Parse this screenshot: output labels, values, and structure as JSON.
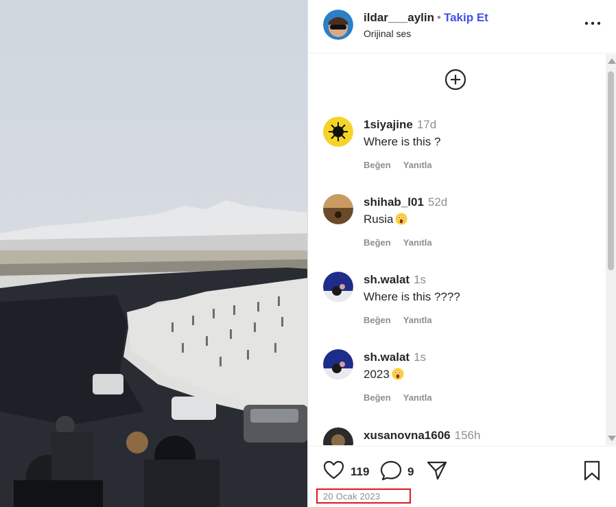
{
  "post": {
    "username": "ildar___aylin",
    "separator": "•",
    "follow_label": "Takip Et",
    "audio_label": "Orijinal ses",
    "more_icon": "more-horizontal-icon"
  },
  "comments": [
    {
      "username": "1siyajine",
      "time": "17d",
      "text": "Where is this ?",
      "emoji": "",
      "like_label": "Beğen",
      "reply_label": "Yanıtla",
      "avatar_color": "#f5d327"
    },
    {
      "username": "shihab_l01",
      "time": "52d",
      "text": "Rusia",
      "emoji": "astonished-face",
      "like_label": "Beğen",
      "reply_label": "Yanıtla",
      "avatar_color": "#6b4a2a"
    },
    {
      "username": "sh.walat",
      "time": "1s",
      "text": "Where is this ????",
      "emoji": "",
      "like_label": "Beğen",
      "reply_label": "Yanıtla",
      "avatar_color": "#1f2d8a"
    },
    {
      "username": "sh.walat",
      "time": "1s",
      "text": "2023",
      "emoji": "astonished-face",
      "like_label": "Beğen",
      "reply_label": "Yanıtla",
      "avatar_color": "#1f2d8a"
    },
    {
      "username": "xusanovna1606",
      "time": "156h",
      "text": "",
      "emoji": "",
      "like_label": "",
      "reply_label": "",
      "avatar_color": "#2b2b2b"
    }
  ],
  "actions": {
    "likes": "119",
    "comments": "9",
    "date": "20 Ocak 2023"
  },
  "colors": {
    "accent": "#3f51e6",
    "highlight": "#e0161f"
  }
}
